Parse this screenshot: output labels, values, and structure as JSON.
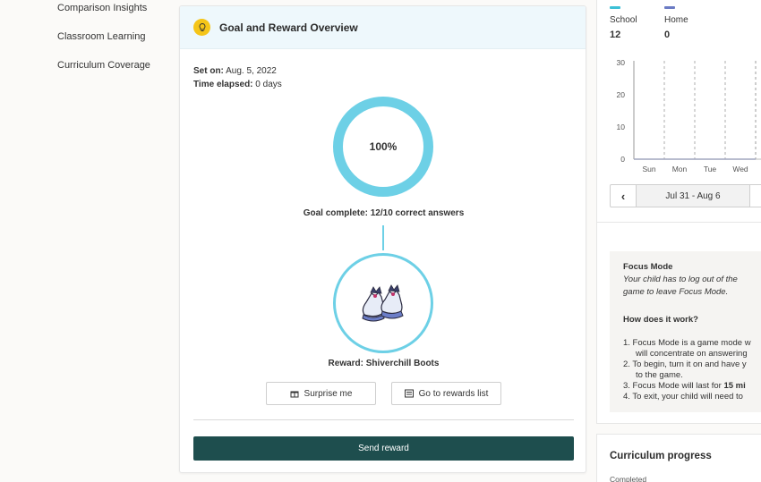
{
  "sidebar": {
    "items": [
      {
        "label": "Comparison Insights"
      },
      {
        "label": "Classroom Learning"
      },
      {
        "label": "Curriculum Coverage"
      }
    ]
  },
  "goal": {
    "title": "Goal and Reward Overview",
    "set_on_label": "Set on:",
    "set_on_value": "Aug. 5, 2022",
    "elapsed_label": "Time elapsed:",
    "elapsed_value": "0 days",
    "progress_text": "100%",
    "progress_fraction": 1.0,
    "complete_text": "Goal complete: 12/10 correct answers",
    "reward_text": "Reward: Shiverchill Boots",
    "surprise_label": "Surprise me",
    "rewards_list_label": "Go to rewards list",
    "send_label": "Send reward"
  },
  "stats": {
    "school_label": "School",
    "school_value": "12",
    "home_label": "Home",
    "home_value": "0",
    "school_color": "#3cc0d6",
    "home_color": "#6b7bc4"
  },
  "chart_data": {
    "type": "line",
    "categories": [
      "Sun",
      "Mon",
      "Tue",
      "Wed"
    ],
    "series": [
      {
        "values": [
          0,
          0,
          0,
          0
        ]
      }
    ],
    "yticks": [
      0,
      10,
      20,
      30
    ],
    "ylim": [
      0,
      30
    ]
  },
  "week_nav": {
    "range": "Jul 31 - Aug 6",
    "prev_icon": "chevron-left-icon"
  },
  "focus_mode": {
    "title": "Focus Mode",
    "desc1": "Your child has to log out of the",
    "desc2": "game to leave Focus Mode.",
    "how_title": "How does it work?",
    "l1": "1. Focus Mode is a game mode w",
    "l2": "will concentrate on answering",
    "l3": "2. To begin, turn it on and have y",
    "l4": "to the game.",
    "l5a": "3. Focus Mode will last for ",
    "l5b": "15 mi",
    "l6": "4. To exit, your child will need to"
  },
  "curriculum": {
    "title": "Curriculum progress",
    "completed_label": "Completed"
  }
}
